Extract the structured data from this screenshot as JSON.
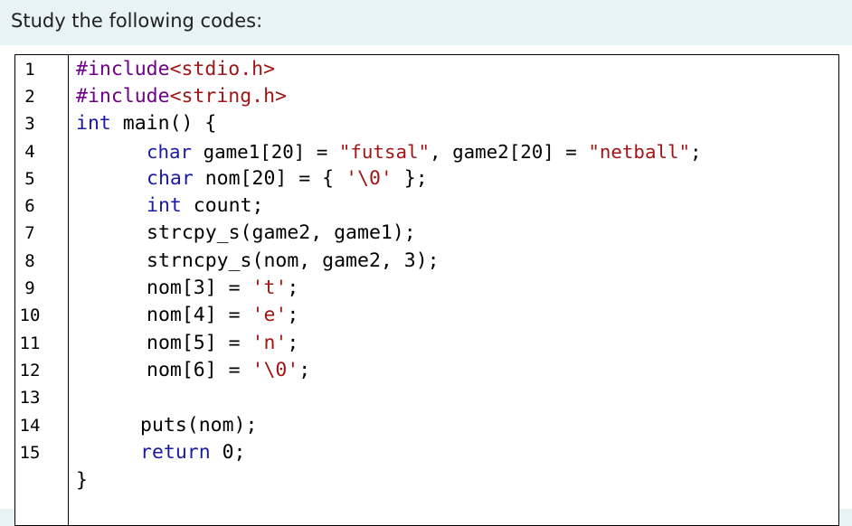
{
  "prompt": "Study the following codes:",
  "line_numbers": [
    "1",
    "2",
    "3",
    "4",
    "5",
    "6",
    "7",
    "8",
    "9",
    "10",
    "11",
    "12",
    "13",
    "14",
    "15"
  ],
  "code": {
    "l1": {
      "pp": "#include",
      "rest": "<stdio.h>"
    },
    "l2": {
      "pp": "#include",
      "rest": "<string.h>"
    },
    "l3": {
      "kw": "int",
      "rest": " main() {"
    },
    "l4": {
      "kw": "char",
      "a": " game1[20] = ",
      "s1": "\"futsal\"",
      "b": ", game2[20] = ",
      "s2": "\"netball\"",
      "c": ";"
    },
    "l5": {
      "kw": "char",
      "a": " nom[20] = { ",
      "s1": "'\\0'",
      "b": " };"
    },
    "l6": {
      "kw": "int",
      "rest": " count;"
    },
    "l7": {
      "text": "strcpy_s(game2, game1);"
    },
    "l8": {
      "text": "strncpy_s(nom, game2, 3);"
    },
    "l9": {
      "a": "nom[3] = ",
      "s": "'t'",
      "b": ";"
    },
    "l10": {
      "a": "nom[4] = ",
      "s": "'e'",
      "b": ";"
    },
    "l11": {
      "a": "nom[5] = ",
      "s": "'n'",
      "b": ";"
    },
    "l12": {
      "a": "nom[6] = ",
      "s": "'\\0'",
      "b": ";"
    },
    "l14": {
      "text": "puts(nom);"
    },
    "l15": {
      "kw": "return",
      "rest": " 0;"
    },
    "l16": {
      "text": "}"
    }
  }
}
